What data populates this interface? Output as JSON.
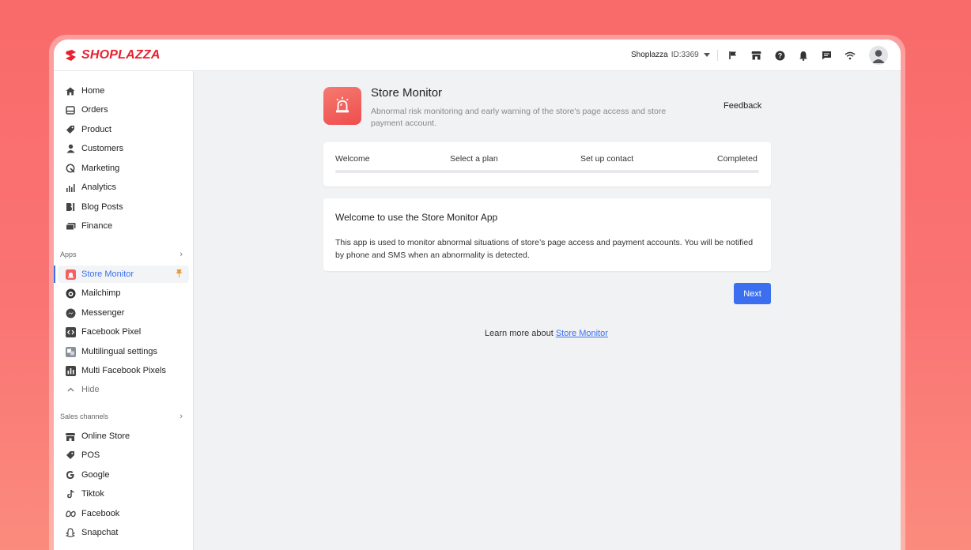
{
  "brand": {
    "name": "SHOPLAZZA",
    "color": "#e8202f"
  },
  "topbar": {
    "store_name": "Shoplazza",
    "store_id": "ID:3369",
    "icons": [
      "flag-icon",
      "store-icon",
      "help-icon",
      "bell-icon",
      "chat-icon",
      "wifi-icon"
    ]
  },
  "sidebar": {
    "main_items": [
      {
        "label": "Home",
        "icon": "home-icon"
      },
      {
        "label": "Orders",
        "icon": "orders-icon"
      },
      {
        "label": "Product",
        "icon": "tag-icon"
      },
      {
        "label": "Customers",
        "icon": "person-icon"
      },
      {
        "label": "Marketing",
        "icon": "marketing-icon"
      },
      {
        "label": "Analytics",
        "icon": "bar-chart-icon"
      },
      {
        "label": "Blog Posts",
        "icon": "blog-icon"
      },
      {
        "label": "Finance",
        "icon": "finance-icon"
      }
    ],
    "apps_label": "Apps",
    "app_items": [
      {
        "label": "Store Monitor",
        "icon": "alarm-icon",
        "active": true
      },
      {
        "label": "Mailchimp",
        "icon": "mailchimp-icon"
      },
      {
        "label": "Messenger",
        "icon": "messenger-icon"
      },
      {
        "label": "Facebook Pixel",
        "icon": "code-icon"
      },
      {
        "label": "Multilingual settings",
        "icon": "translate-icon"
      },
      {
        "label": "Multi Facebook Pixels",
        "icon": "pixels-icon"
      }
    ],
    "hide_label": "Hide",
    "sales_label": "Sales channels",
    "sales_items": [
      {
        "label": "Online Store",
        "icon": "store-icon"
      },
      {
        "label": "POS",
        "icon": "pos-icon"
      },
      {
        "label": "Google",
        "icon": "google-icon"
      },
      {
        "label": "Tiktok",
        "icon": "tiktok-icon"
      },
      {
        "label": "Facebook",
        "icon": "meta-icon"
      },
      {
        "label": "Snapchat",
        "icon": "snapchat-icon"
      }
    ]
  },
  "app": {
    "title": "Store Monitor",
    "description": "Abnormal risk monitoring and early warning of the store's page access and store payment account.",
    "feedback_label": "Feedback"
  },
  "steps": {
    "labels": [
      "Welcome",
      "Select a plan",
      "Set up contact",
      "Completed"
    ],
    "progress": 0
  },
  "welcome": {
    "title": "Welcome to use the Store Monitor App",
    "body": "This app is used to monitor abnormal situations of store’s page access and payment accounts. You will be notified by phone and SMS when an abnormality is detected."
  },
  "next_label": "Next",
  "learn_more": {
    "prefix": "Learn more about",
    "link": "Store Monitor"
  },
  "colors": {
    "accent": "#3b6ff0",
    "background": "#f96a6a"
  }
}
